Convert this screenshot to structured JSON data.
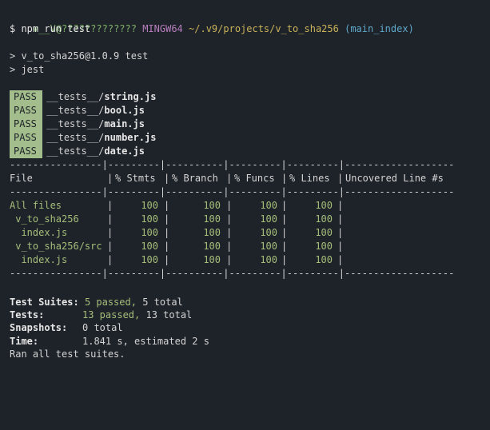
{
  "prompt": {
    "user": "v__V",
    "at": "@",
    "host": "?????????????",
    "system": "MINGW64",
    "path": "~/.v9/projects/v_to_sha256",
    "branch": "(main_index)"
  },
  "command": "$ npm run test",
  "script_lines": [
    "> v_to_sha256@1.0.9 test",
    "> jest"
  ],
  "test_files": [
    {
      "badge": "PASS",
      "dir": "__tests__/",
      "file": "string.js"
    },
    {
      "badge": "PASS",
      "dir": "__tests__/",
      "file": "bool.js"
    },
    {
      "badge": "PASS",
      "dir": "__tests__/",
      "file": "main.js"
    },
    {
      "badge": "PASS",
      "dir": "__tests__/",
      "file": "number.js"
    },
    {
      "badge": "PASS",
      "dir": "__tests__/",
      "file": "date.js"
    }
  ],
  "coverage": {
    "separator": "----------------|---------|----------|---------|---------|-------------------",
    "headers": [
      "File",
      "% Stmts",
      "% Branch",
      "% Funcs",
      "% Lines",
      "Uncovered Line #s"
    ],
    "rows": [
      {
        "file": "All files",
        "stmts": "100",
        "branch": "100",
        "funcs": "100",
        "lines": "100",
        "uncovered": ""
      },
      {
        "file": " v_to_sha256",
        "stmts": "100",
        "branch": "100",
        "funcs": "100",
        "lines": "100",
        "uncovered": ""
      },
      {
        "file": "  index.js",
        "stmts": "100",
        "branch": "100",
        "funcs": "100",
        "lines": "100",
        "uncovered": ""
      },
      {
        "file": " v_to_sha256/src",
        "stmts": "100",
        "branch": "100",
        "funcs": "100",
        "lines": "100",
        "uncovered": ""
      },
      {
        "file": "  index.js",
        "stmts": "100",
        "branch": "100",
        "funcs": "100",
        "lines": "100",
        "uncovered": ""
      }
    ]
  },
  "summary": {
    "suites_label": "Test Suites:",
    "suites_passed": "5 passed,",
    "suites_total": "5 total",
    "tests_label": "Tests:",
    "tests_passed": "13 passed,",
    "tests_total": "13 total",
    "snapshots_label": "Snapshots:",
    "snapshots_value": "0 total",
    "time_label": "Time:",
    "time_value": "1.841 s, estimated 2 s",
    "ran": "Ran all test suites."
  },
  "colors": {
    "background": "#1e2329",
    "pass_badge": "#a3be8c",
    "green": "#7fb069",
    "magenta": "#b77dbd",
    "yellow": "#c9b25a",
    "cyan": "#5fa8c9"
  }
}
